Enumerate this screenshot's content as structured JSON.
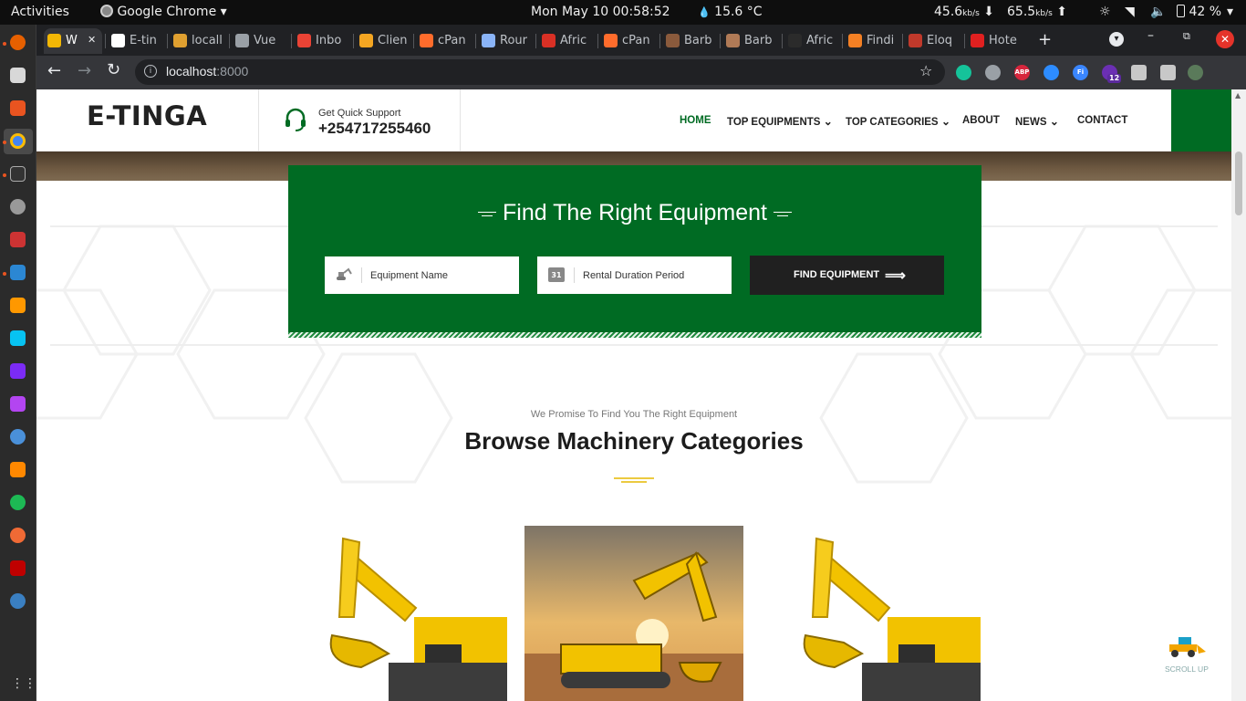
{
  "system_bar": {
    "activities": "Activities",
    "app_name": "Google Chrome",
    "datetime": "Mon May 10  00:58:52",
    "weather": "15.6 °C",
    "net_down": "45.6",
    "net_down_unit": "kb/s",
    "net_up": "65.5",
    "net_up_unit": "kb/s",
    "battery": "42 %"
  },
  "tabs": [
    {
      "title": "W",
      "fav_color": "#f2b705",
      "active": true
    },
    {
      "title": "E-tin",
      "fav_color": "#ffffff"
    },
    {
      "title": "locall",
      "fav_color": "#e0a030"
    },
    {
      "title": "Vue",
      "fav_color": "#9aa0a6"
    },
    {
      "title": "Inbo",
      "fav_color": "#ea4335"
    },
    {
      "title": "Clien",
      "fav_color": "#f4a622"
    },
    {
      "title": "cPan",
      "fav_color": "#ff6c2c"
    },
    {
      "title": "Rour",
      "fav_color": "#8ab4f8"
    },
    {
      "title": "Afric",
      "fav_color": "#d93025"
    },
    {
      "title": "cPan",
      "fav_color": "#ff6c2c"
    },
    {
      "title": "Barb",
      "fav_color": "#8a5a3c"
    },
    {
      "title": "Barb",
      "fav_color": "#b07a56"
    },
    {
      "title": "Afric",
      "fav_color": "#2b2b2b"
    },
    {
      "title": "Findi",
      "fav_color": "#f48024"
    },
    {
      "title": "Eloq",
      "fav_color": "#c0392b"
    },
    {
      "title": "Hote",
      "fav_color": "#e02020"
    }
  ],
  "address_bar": {
    "host": "localhost",
    "port": ":8000"
  },
  "extensions": [
    {
      "name": "grammarly",
      "color": "#15c39a"
    },
    {
      "name": "ext-gray",
      "color": "#9aa0a6"
    },
    {
      "name": "adblock-plus",
      "color": "#d7263d",
      "text": "ABP"
    },
    {
      "name": "zoom",
      "color": "#2d8cff"
    },
    {
      "name": "ext-fi",
      "color": "#3a86ff",
      "text": "Fi"
    },
    {
      "name": "ext-badge",
      "color": "#6b2fb3",
      "badge": "12"
    },
    {
      "name": "puzzle",
      "color": "#c8c8c8"
    },
    {
      "name": "media",
      "color": "#c8c8c8"
    },
    {
      "name": "profile",
      "color": "#5a7a5a"
    }
  ],
  "site": {
    "logo": "E-TINGA",
    "support_label": "Get Quick Support",
    "support_phone": "+254717255460",
    "nav": [
      {
        "label": "HOME",
        "active": true,
        "dropdown": false
      },
      {
        "label": "TOP EQUIPMENTS",
        "active": false,
        "dropdown": true
      },
      {
        "label": "TOP CATEGORIES",
        "active": false,
        "dropdown": true
      },
      {
        "label": "ABOUT",
        "active": false,
        "dropdown": false
      },
      {
        "label": "NEWS",
        "active": false,
        "dropdown": true
      },
      {
        "label": "CONTACT",
        "active": false,
        "dropdown": false
      }
    ],
    "brand_green": "#006b23",
    "search": {
      "title": "Find The Right Equipment",
      "equipment_placeholder": "Equipment Name",
      "duration_placeholder": "Rental Duration Period",
      "calendar_day": "31",
      "button_label": "FIND EQUIPMENT"
    },
    "categories": {
      "subtitle": "We Promise To Find You The Right Equipment",
      "title": "Browse Machinery Categories",
      "accent": "#e6b800"
    },
    "scroll_up_label": "SCROLL UP"
  }
}
